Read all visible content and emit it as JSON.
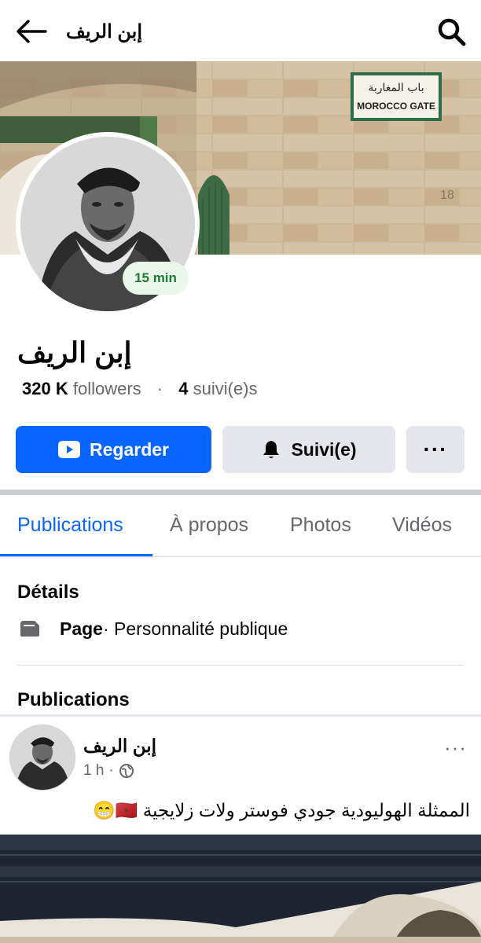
{
  "header": {
    "title": "إبن الريف"
  },
  "profile": {
    "name": "إبن الريف",
    "badge": "15 min",
    "followers_count": "320 K",
    "followers_label": "followers",
    "separator": "·",
    "following_count": "4",
    "following_label": "suivi(e)s"
  },
  "cover": {
    "sign_arabic": "باب المغاربة",
    "sign_english": "MOROCCO  GATE",
    "wall_mark": "18"
  },
  "actions": {
    "watch_label": "Regarder",
    "follow_label": "Suivi(e)",
    "more_label": "···"
  },
  "tabs": [
    {
      "label": "Publications",
      "active": true
    },
    {
      "label": "À propos",
      "active": false
    },
    {
      "label": "Photos",
      "active": false
    },
    {
      "label": "Vidéos",
      "active": false
    }
  ],
  "details": {
    "title": "Détails",
    "type_bold": "Page",
    "type_rest": " · Personnalité publique"
  },
  "publications": {
    "title": "Publications"
  },
  "post": {
    "author": "إبن الريف",
    "time": "1 h",
    "meta_sep": "·",
    "more": "···",
    "text": "الممثلة الهوليودية جودي فوستر ولات زلايجية 🇲🇦😁"
  },
  "colors": {
    "accent": "#0866ff",
    "badge_text": "#1f7a36",
    "secondary_text": "#65676b"
  }
}
